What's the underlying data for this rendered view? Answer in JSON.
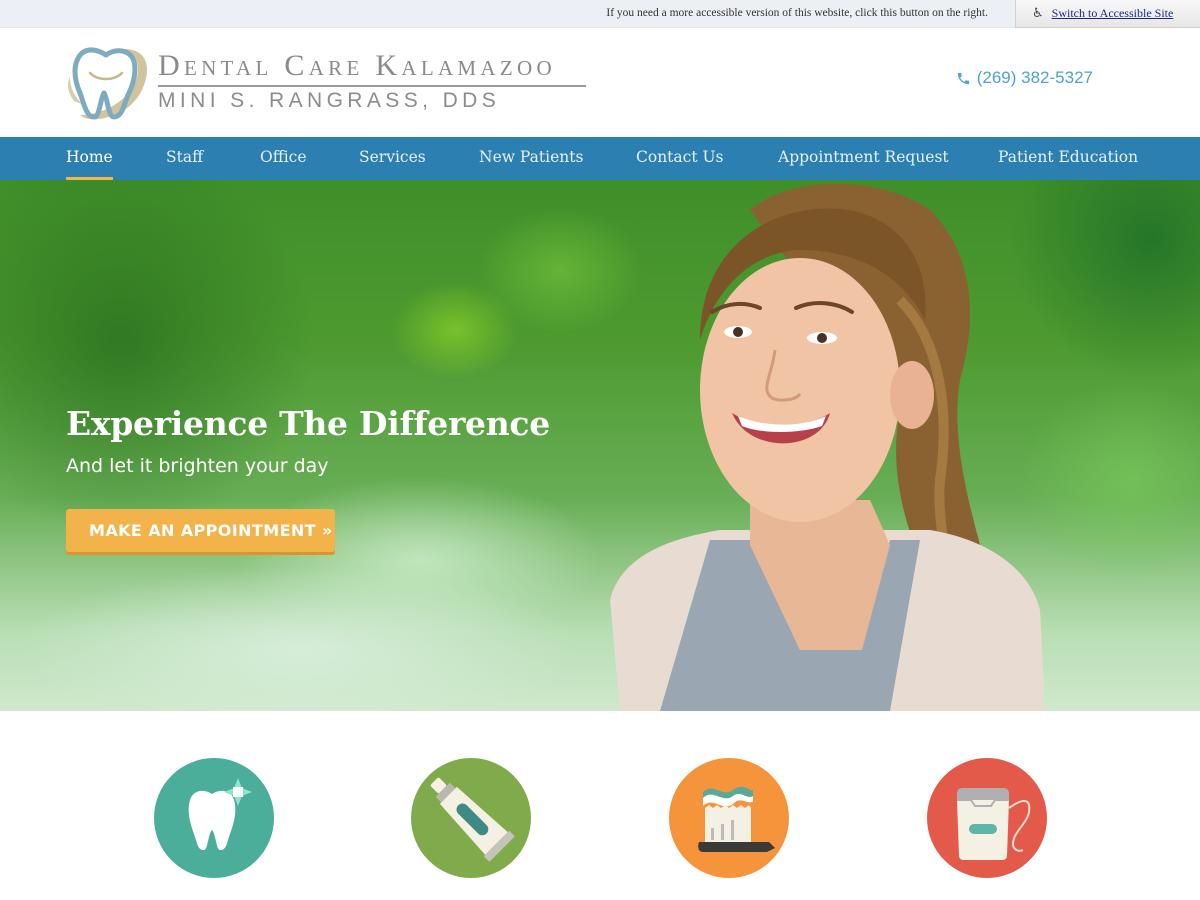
{
  "accessibility_bar": {
    "message": "If you need a more accessible version of this website, click this button on the right.",
    "button_label": "Switch to Accessible Site",
    "button_icon": "wheelchair-icon"
  },
  "header": {
    "logo": {
      "title": "Dental Care Kalamazoo",
      "subtitle": "MINI S. RANGRASS, DDS",
      "icon": "tooth-logo-icon"
    },
    "phone": {
      "icon": "phone-icon",
      "number": "(269) 382-5327"
    }
  },
  "nav": {
    "items": [
      {
        "label": "Home",
        "active": true
      },
      {
        "label": "Staff",
        "active": false
      },
      {
        "label": "Office",
        "active": false
      },
      {
        "label": "Services",
        "active": false
      },
      {
        "label": "New Patients",
        "active": false
      },
      {
        "label": "Contact Us",
        "active": false
      },
      {
        "label": "Appointment Request",
        "active": false
      },
      {
        "label": "Patient Education",
        "active": false
      }
    ]
  },
  "hero": {
    "title": "Experience The Difference",
    "subtitle": "And let it brighten your day",
    "cta_label": "MAKE AN APPOINTMENT »",
    "image": "smiling-woman-photo"
  },
  "features": [
    {
      "icon": "sparkling-tooth-icon",
      "color": "#4aae9b"
    },
    {
      "icon": "toothpaste-tube-icon",
      "color": "#7fab4b"
    },
    {
      "icon": "toothbrush-icon",
      "color": "#f6943b"
    },
    {
      "icon": "dental-floss-icon",
      "color": "#e35a4b"
    }
  ],
  "colors": {
    "nav_background": "#2c80b1",
    "nav_active_underline": "#f0b64a",
    "cta_button": "#f2b34b",
    "phone_text": "#4fa3cf",
    "accessibility_bar": "#eceff3"
  }
}
